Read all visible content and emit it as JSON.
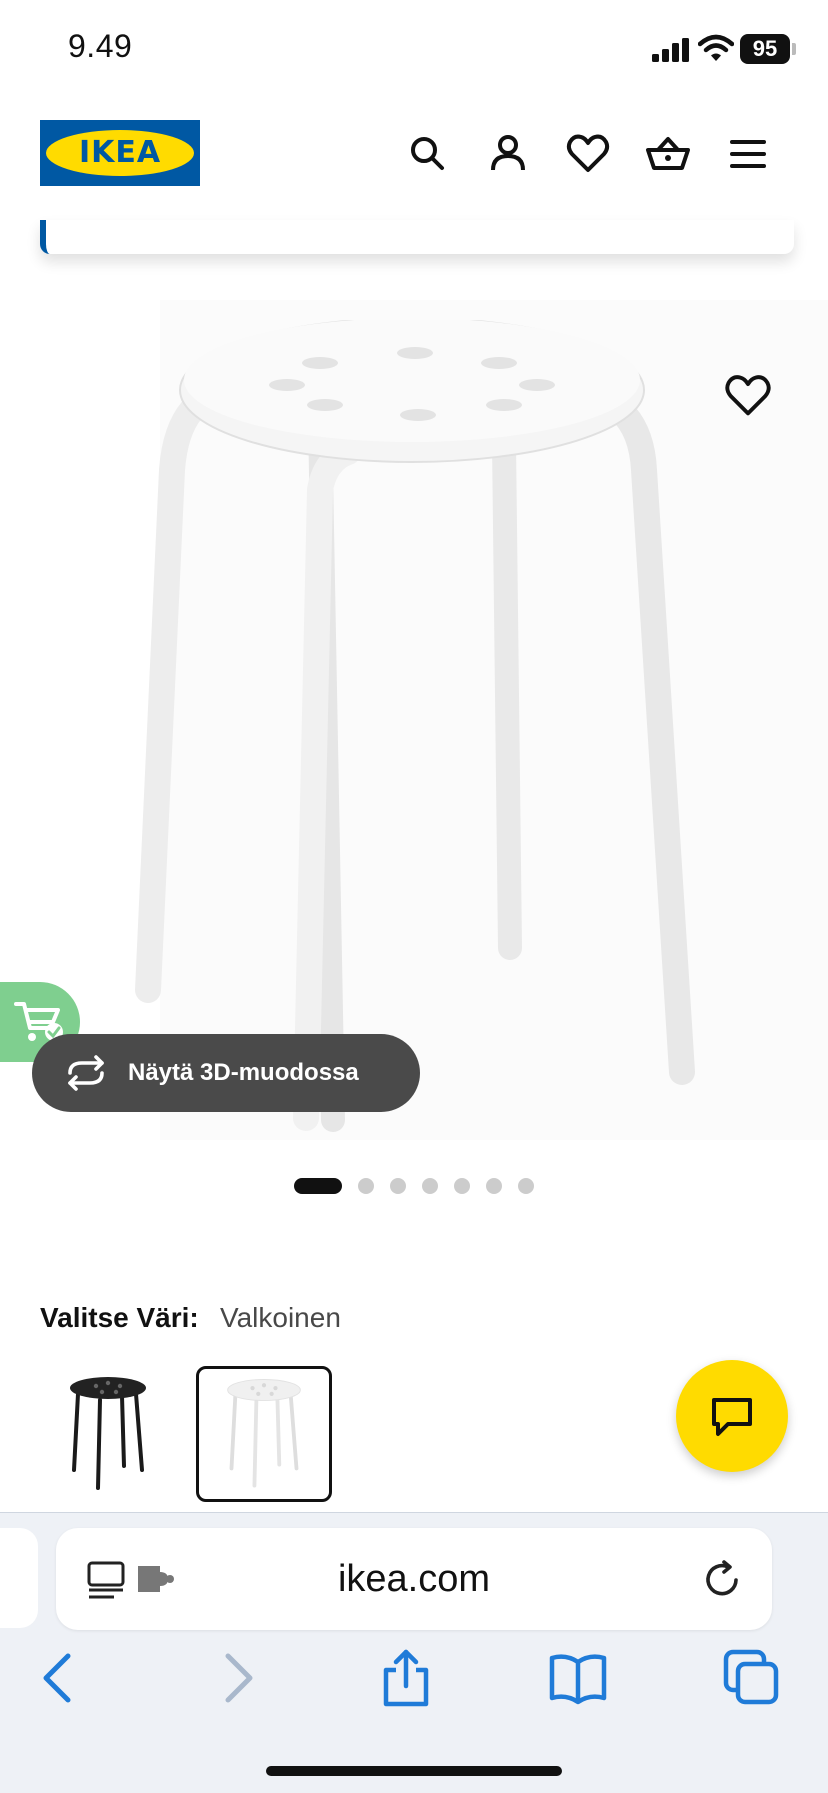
{
  "status_bar": {
    "time": "9.49",
    "battery": "95"
  },
  "header": {
    "logo_text": "IKEA",
    "icons": [
      "search-icon",
      "account-icon",
      "favourites-icon",
      "basket-icon",
      "menu-icon"
    ]
  },
  "product": {
    "image_alt": "white stool",
    "view_3d_label": "Näytä 3D-muodossa",
    "image_count": 7,
    "active_image_index": 0
  },
  "color_selection": {
    "label": "Valitse Väri:",
    "selected": "Valkoinen",
    "options": [
      {
        "name": "black-stool",
        "color": "#1a1a1a",
        "selected": false
      },
      {
        "name": "white-stool",
        "color": "#f2f2f2",
        "selected": true
      }
    ]
  },
  "browser": {
    "url": "ikea.com"
  },
  "colors": {
    "ikea_blue": "#0058a3",
    "ikea_yellow": "#ffdb00",
    "ios_blue": "#1f7bd8"
  }
}
